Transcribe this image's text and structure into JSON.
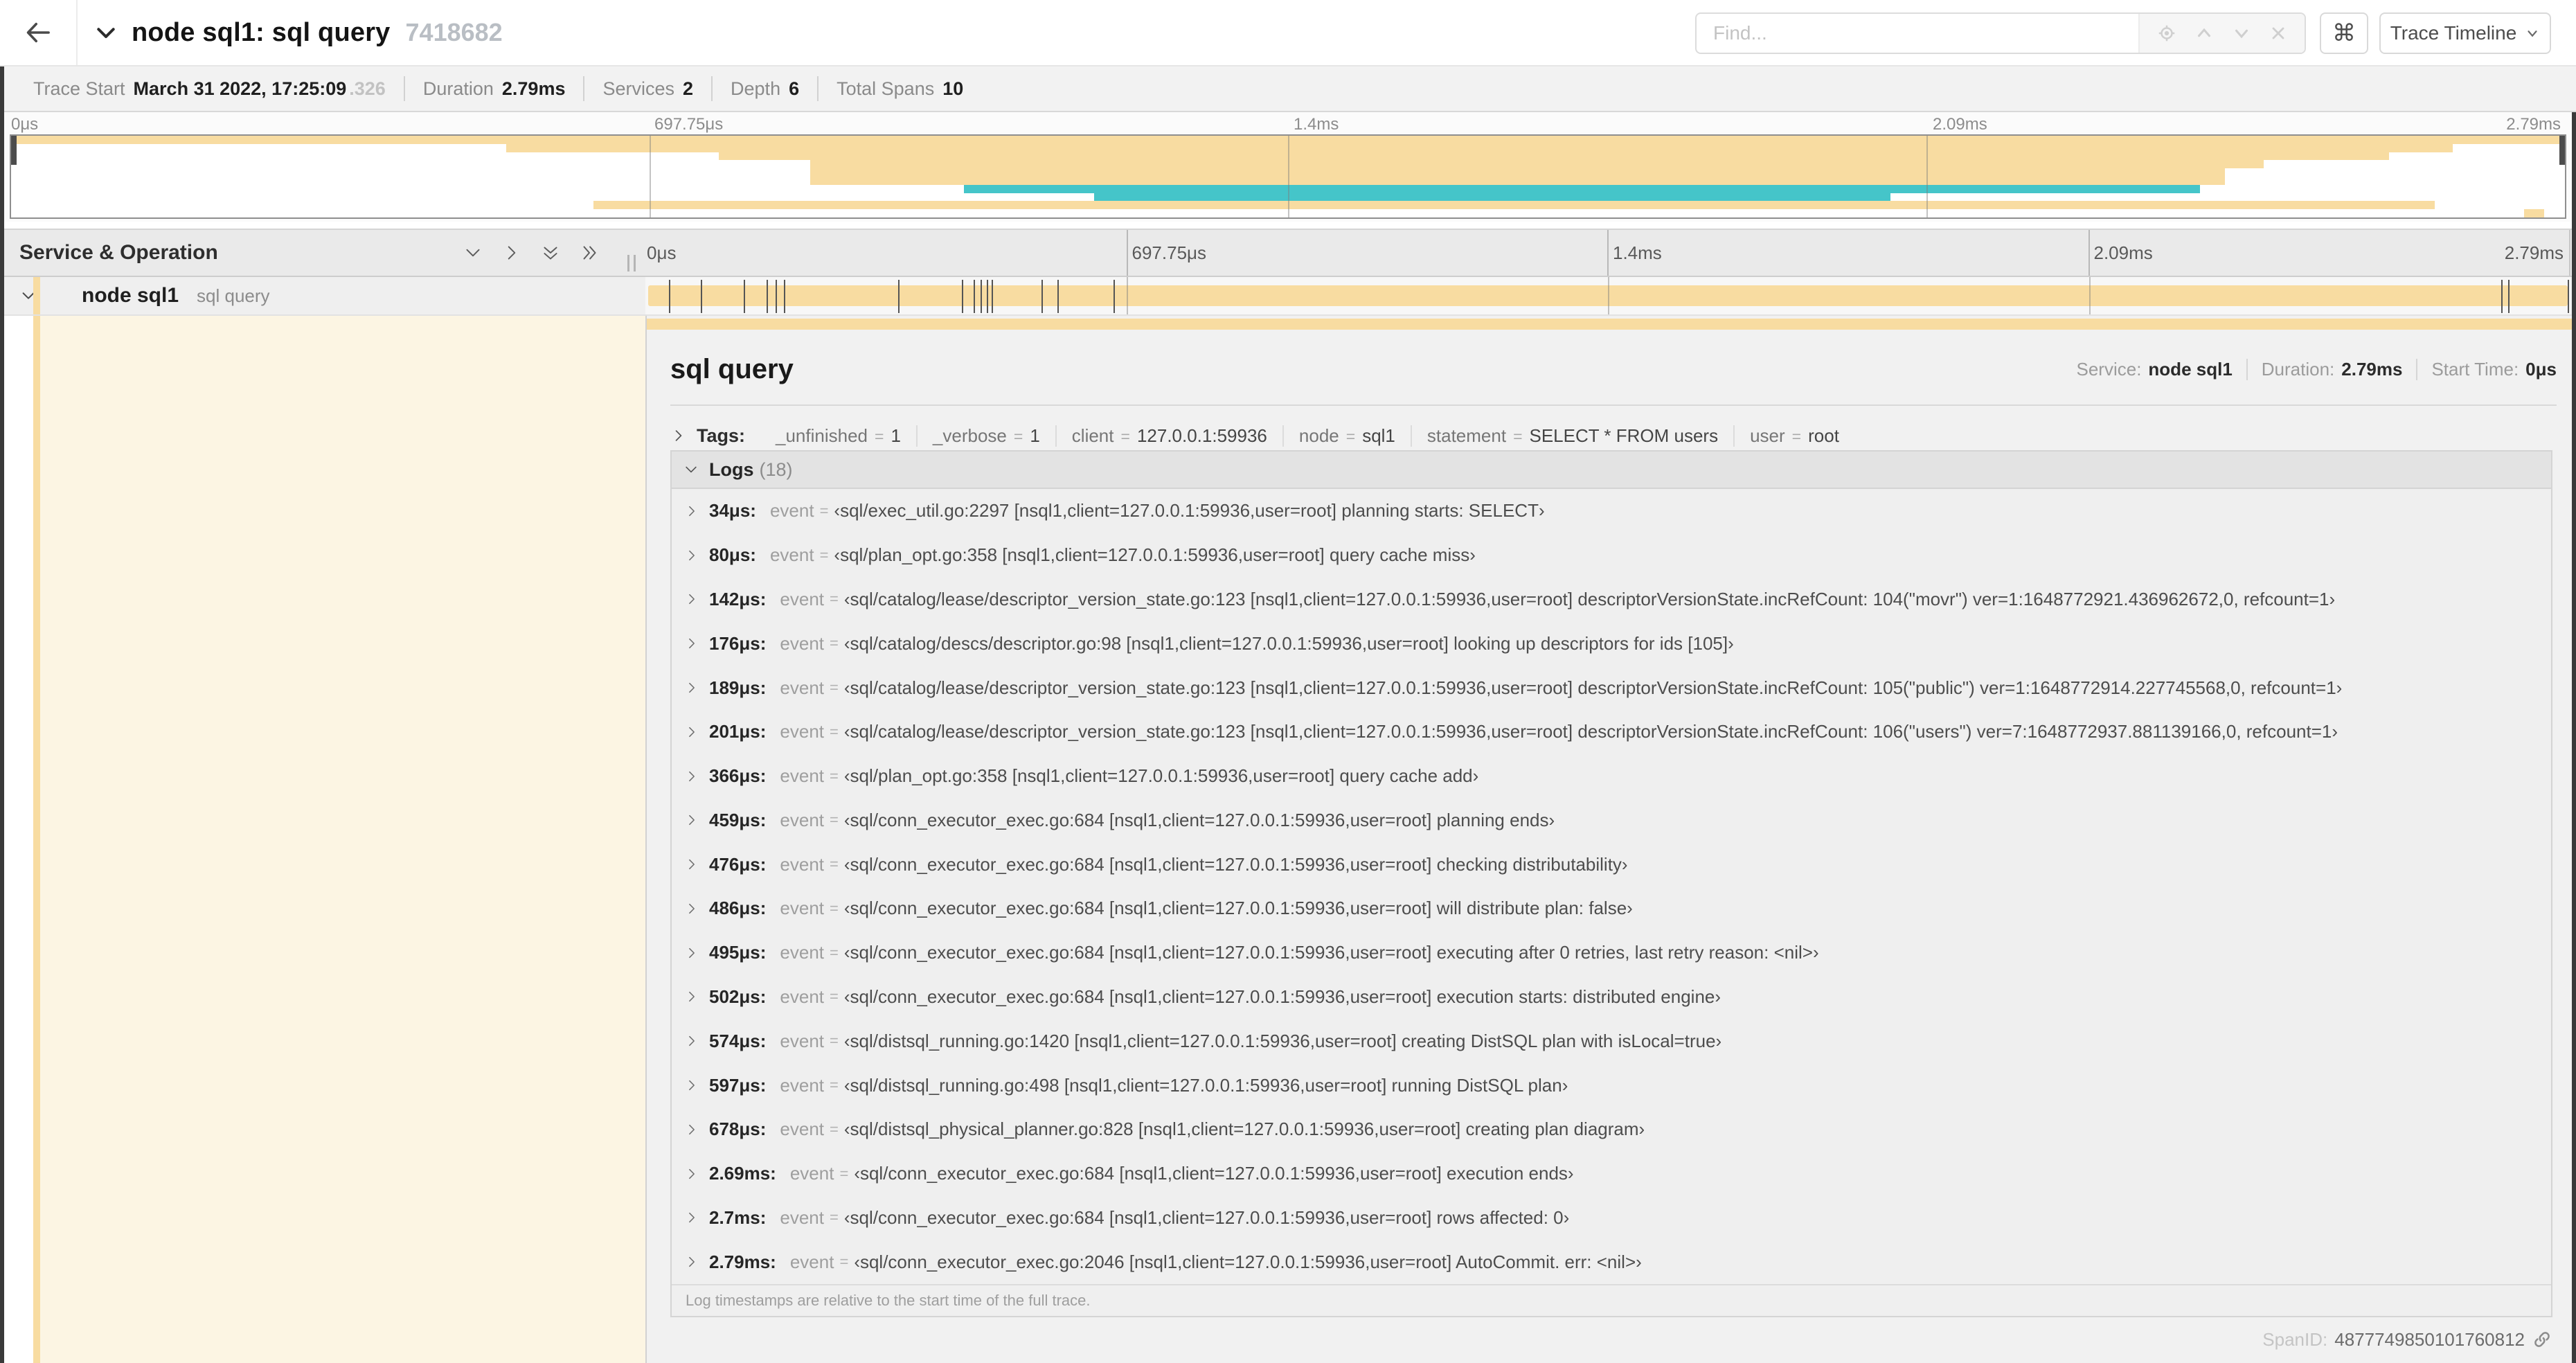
{
  "colors": {
    "tan": "#F8DCA1",
    "teal": "#45C5C9",
    "cream": "#FCF5E3"
  },
  "header": {
    "title": "node sql1: sql query",
    "trace_id": "7418682",
    "find_placeholder": "Find...",
    "shortcut_key": "⌘",
    "view_button_label": "Trace Timeline"
  },
  "trace_info": {
    "items": [
      {
        "label": "Trace Start",
        "value": "March 31 2022, 17:25:09",
        "value_suffix": ".326"
      },
      {
        "label": "Duration",
        "value": "2.79ms"
      },
      {
        "label": "Services",
        "value": "2"
      },
      {
        "label": "Depth",
        "value": "6"
      },
      {
        "label": "Total Spans",
        "value": "10"
      }
    ]
  },
  "minimap": {
    "ticks": [
      "0μs",
      "697.75μs",
      "1.4ms",
      "2.09ms",
      "2.79ms"
    ],
    "bars": [
      {
        "row": 1,
        "start": 0,
        "end": 100,
        "color": "tan"
      },
      {
        "row": 2,
        "start": 19.4,
        "end": 95.6,
        "color": "tan"
      },
      {
        "row": 3,
        "start": 27.7,
        "end": 93.1,
        "color": "tan"
      },
      {
        "row": 4,
        "start": 31.3,
        "end": 88.2,
        "color": "tan"
      },
      {
        "row": 5,
        "start": 31.3,
        "end": 86.7,
        "color": "tan"
      },
      {
        "row": 6,
        "start": 31.3,
        "end": 86.7,
        "color": "tan"
      },
      {
        "row": 7,
        "start": 37.3,
        "end": 85.7,
        "color": "teal"
      },
      {
        "row": 8,
        "start": 42.4,
        "end": 73.6,
        "color": "teal"
      },
      {
        "row": 9,
        "start": 22.8,
        "end": 94.9,
        "color": "tan"
      },
      {
        "row": 10,
        "start": 98.4,
        "end": 99.2,
        "color": "tan"
      }
    ]
  },
  "timeline": {
    "column_header": "Service & Operation",
    "ticks": [
      "0μs",
      "697.75μs",
      "1.4ms",
      "2.09ms",
      "2.79ms"
    ],
    "row": {
      "service": "node sql1",
      "operation": "sql query"
    }
  },
  "detail": {
    "operation_name": "sql query",
    "meta": [
      {
        "label": "Service:",
        "value": "node sql1"
      },
      {
        "label": "Duration:",
        "value": "2.79ms"
      },
      {
        "label": "Start Time:",
        "value": "0μs"
      }
    ],
    "tags_label": "Tags:",
    "eq": "=",
    "tags": [
      {
        "key": "_unfinished",
        "value": "1"
      },
      {
        "key": "_verbose",
        "value": "1"
      },
      {
        "key": "client",
        "value": "127.0.0.1:59936"
      },
      {
        "key": "node",
        "value": "sql1"
      },
      {
        "key": "statement",
        "value": "SELECT * FROM users"
      },
      {
        "key": "user",
        "value": "root"
      }
    ],
    "logs_label": "Logs",
    "logs_count": "(18)",
    "event_label": "event",
    "logs": [
      {
        "ts": "34μs:",
        "pct": 1.22,
        "msg": "‹sql/exec_util.go:2297 [nsql1,client=127.0.0.1:59936,user=root] planning starts: SELECT›"
      },
      {
        "ts": "80μs:",
        "pct": 2.87,
        "msg": "‹sql/plan_opt.go:358 [nsql1,client=127.0.0.1:59936,user=root] query cache miss›"
      },
      {
        "ts": "142μs:",
        "pct": 5.09,
        "msg": "‹sql/catalog/lease/descriptor_version_state.go:123 [nsql1,client=127.0.0.1:59936,user=root] descriptorVersionState.incRefCount: 104(\"movr\") ver=1:1648772921.436962672,0, refcount=1›"
      },
      {
        "ts": "176μs:",
        "pct": 6.31,
        "msg": "‹sql/catalog/descs/descriptor.go:98 [nsql1,client=127.0.0.1:59936,user=root] looking up descriptors for ids [105]›"
      },
      {
        "ts": "189μs:",
        "pct": 6.77,
        "msg": "‹sql/catalog/lease/descriptor_version_state.go:123 [nsql1,client=127.0.0.1:59936,user=root] descriptorVersionState.incRefCount: 105(\"public\") ver=1:1648772914.227745568,0, refcount=1›"
      },
      {
        "ts": "201μs:",
        "pct": 7.2,
        "msg": "‹sql/catalog/lease/descriptor_version_state.go:123 [nsql1,client=127.0.0.1:59936,user=root] descriptorVersionState.incRefCount: 106(\"users\") ver=7:1648772937.881139166,0, refcount=1›"
      },
      {
        "ts": "366μs:",
        "pct": 13.12,
        "msg": "‹sql/plan_opt.go:358 [nsql1,client=127.0.0.1:59936,user=root] query cache add›"
      },
      {
        "ts": "459μs:",
        "pct": 16.45,
        "msg": "‹sql/conn_executor_exec.go:684 [nsql1,client=127.0.0.1:59936,user=root] planning ends›"
      },
      {
        "ts": "476μs:",
        "pct": 17.06,
        "msg": "‹sql/conn_executor_exec.go:684 [nsql1,client=127.0.0.1:59936,user=root] checking distributability›"
      },
      {
        "ts": "486μs:",
        "pct": 17.42,
        "msg": "‹sql/conn_executor_exec.go:684 [nsql1,client=127.0.0.1:59936,user=root] will distribute plan: false›"
      },
      {
        "ts": "495μs:",
        "pct": 17.74,
        "msg": "‹sql/conn_executor_exec.go:684 [nsql1,client=127.0.0.1:59936,user=root] executing after 0 retries, last retry reason: <nil>›"
      },
      {
        "ts": "502μs:",
        "pct": 18.0,
        "msg": "‹sql/conn_executor_exec.go:684 [nsql1,client=127.0.0.1:59936,user=root] execution starts: distributed engine›"
      },
      {
        "ts": "574μs:",
        "pct": 20.57,
        "msg": "‹sql/distsql_running.go:1420 [nsql1,client=127.0.0.1:59936,user=root] creating DistSQL plan with isLocal=true›"
      },
      {
        "ts": "597μs:",
        "pct": 21.4,
        "msg": "‹sql/distsql_running.go:498 [nsql1,client=127.0.0.1:59936,user=root] running DistSQL plan›"
      },
      {
        "ts": "678μs:",
        "pct": 24.3,
        "msg": "‹sql/distsql_physical_planner.go:828 [nsql1,client=127.0.0.1:59936,user=root] creating plan diagram›"
      },
      {
        "ts": "2.69ms:",
        "pct": 96.42,
        "msg": "‹sql/conn_executor_exec.go:684 [nsql1,client=127.0.0.1:59936,user=root] execution ends›"
      },
      {
        "ts": "2.7ms:",
        "pct": 96.77,
        "msg": "‹sql/conn_executor_exec.go:684 [nsql1,client=127.0.0.1:59936,user=root] rows affected: 0›"
      },
      {
        "ts": "2.79ms:",
        "pct": 99.85,
        "msg": "‹sql/conn_executor_exec.go:2046 [nsql1,client=127.0.0.1:59936,user=root] AutoCommit. err: <nil>›"
      }
    ],
    "footer_note": "Log timestamps are relative to the start time of the full trace.",
    "span_id_label": "SpanID:",
    "span_id": "4877749850101760812"
  }
}
